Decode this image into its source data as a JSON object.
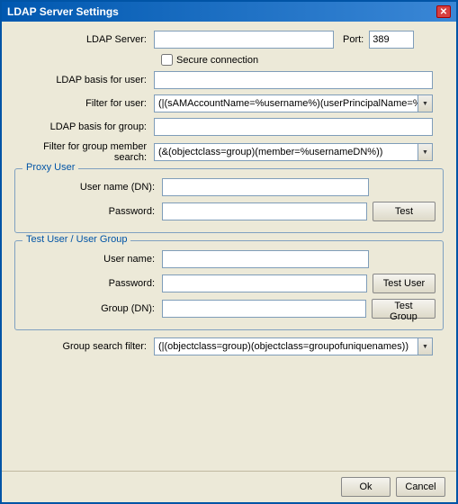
{
  "window": {
    "title": "LDAP Server Settings",
    "close_label": "✕"
  },
  "form": {
    "ldap_server_label": "LDAP Server:",
    "ldap_server_value": "",
    "port_label": "Port:",
    "port_value": "389",
    "secure_label": "Secure connection",
    "ldap_basis_user_label": "LDAP basis for user:",
    "ldap_basis_user_value": "",
    "filter_user_label": "Filter for user:",
    "filter_user_value": "(|(sAMAccountName=%username%)(userPrincipalName=%",
    "ldap_basis_group_label": "LDAP basis for group:",
    "ldap_basis_group_value": "",
    "filter_group_label": "Filter for group member search:",
    "filter_group_value": "(&(objectclass=group)(member=%usernameDN%))",
    "proxy_user": {
      "title": "Proxy User",
      "username_label": "User name (DN):",
      "username_value": "",
      "password_label": "Password:",
      "password_value": "",
      "test_btn": "Test"
    },
    "test_user_group": {
      "title": "Test User / User Group",
      "username_label": "User name:",
      "username_value": "",
      "password_label": "Password:",
      "password_value": "",
      "test_user_btn": "Test User",
      "group_label": "Group (DN):",
      "group_value": "",
      "test_group_btn": "Test Group"
    },
    "group_search_filter_label": "Group search filter:",
    "group_search_filter_value": "(|(objectclass=group)(objectclass=groupofuniquenames))",
    "ok_btn": "Ok",
    "cancel_btn": "Cancel"
  }
}
